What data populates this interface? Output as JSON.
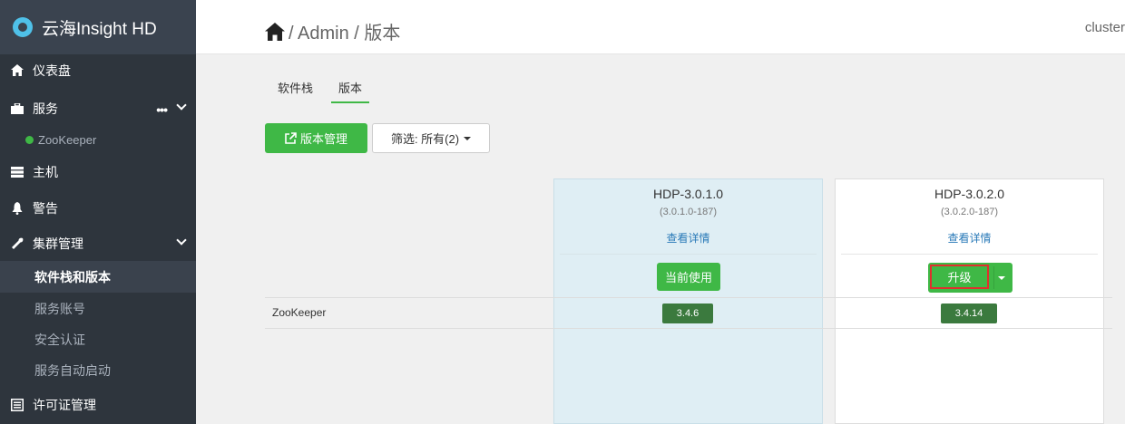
{
  "brand": {
    "title": "云海Insight HD"
  },
  "sidebar": {
    "items": [
      {
        "label": "仪表盘",
        "icon": "home-icon"
      },
      {
        "label": "服务",
        "icon": "briefcase-icon"
      },
      {
        "label": "ZooKeeper",
        "icon": "status-dot-icon",
        "status_color": "#3fb846"
      },
      {
        "label": "主机",
        "icon": "server-icon"
      },
      {
        "label": "警告",
        "icon": "bell-icon"
      },
      {
        "label": "集群管理",
        "icon": "wrench-icon"
      },
      {
        "label": "软件栈和版本"
      },
      {
        "label": "服务账号"
      },
      {
        "label": "安全认证"
      },
      {
        "label": "服务自动启动"
      },
      {
        "label": "许可证管理",
        "icon": "list-icon"
      }
    ]
  },
  "header": {
    "crumb": "/ Admin / 版本",
    "user": "cluster"
  },
  "tabs": [
    {
      "label": "软件栈"
    },
    {
      "label": "版本"
    }
  ],
  "toolbar": {
    "manage_label": "版本管理",
    "filter_label": "筛选: 所有(2)"
  },
  "versions": [
    {
      "name": "HDP-3.0.1.0",
      "build": "(3.0.1.0-187)",
      "details": "查看详情",
      "action": "当前使用",
      "zookeeper": "3.4.6"
    },
    {
      "name": "HDP-3.0.2.0",
      "build": "(3.0.2.0-187)",
      "details": "查看详情",
      "action": "升级",
      "zookeeper": "3.4.14"
    }
  ],
  "table": {
    "row_label": "ZooKeeper"
  },
  "colors": {
    "accent": "#3fb846",
    "sidebar": "#2e353d",
    "badge": "#3b7a3e",
    "highlight": "#e0302d"
  }
}
